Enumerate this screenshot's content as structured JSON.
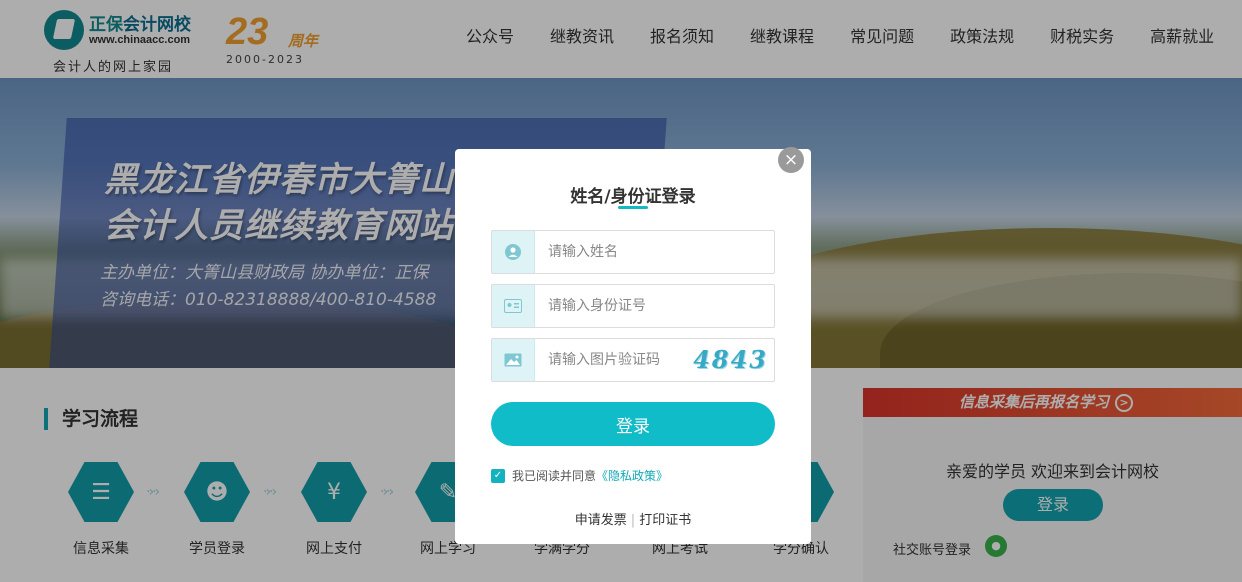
{
  "header": {
    "logo_name_a": "正保",
    "logo_name_b": "会计网校",
    "logo_url": "www.chinaacc.com",
    "logo_slogan": "会计人的网上家园",
    "anniversary_number": "23",
    "anniversary_unit": "周年",
    "anniversary_years": "2000-2023",
    "nav": [
      "公众号",
      "继教资讯",
      "报名须知",
      "继教课程",
      "常见问题",
      "政策法规",
      "财税实务",
      "高薪就业"
    ]
  },
  "banner": {
    "title_line1": "黑龙江省伊春市大箐山",
    "title_line2": "会计人员继续教育网站",
    "subtitle_line1": "主办单位：大箐山县财政局  协办单位：正保",
    "subtitle_line2": "咨询电话：010-82318888/400-810-4588"
  },
  "process": {
    "title": "学习流程",
    "steps": [
      "信息采集",
      "学员登录",
      "网上支付",
      "网上学习",
      "学满学分",
      "网上考试",
      "学分确认"
    ]
  },
  "side": {
    "banner_text": "信息采集后再报名学习",
    "welcome": "亲爱的学员 欢迎来到会计网校",
    "login_label": "登录",
    "social_label": "社交账号登录"
  },
  "modal": {
    "close_glyph": "×",
    "title": "姓名/身份证登录",
    "name_placeholder": "请输入姓名",
    "id_placeholder": "请输入身份证号",
    "captcha_placeholder": "请输入图片验证码",
    "captcha_text": "4843",
    "login_button": "登录",
    "agree_text": "我已阅读并同意",
    "privacy_link": "《隐私政策》",
    "invoice_link": "申请发票",
    "certificate_link": "打印证书"
  },
  "colors": {
    "accent": "#10bcc8",
    "teal_dark": "#129ea8",
    "side_banner_red": "#d9342b"
  }
}
